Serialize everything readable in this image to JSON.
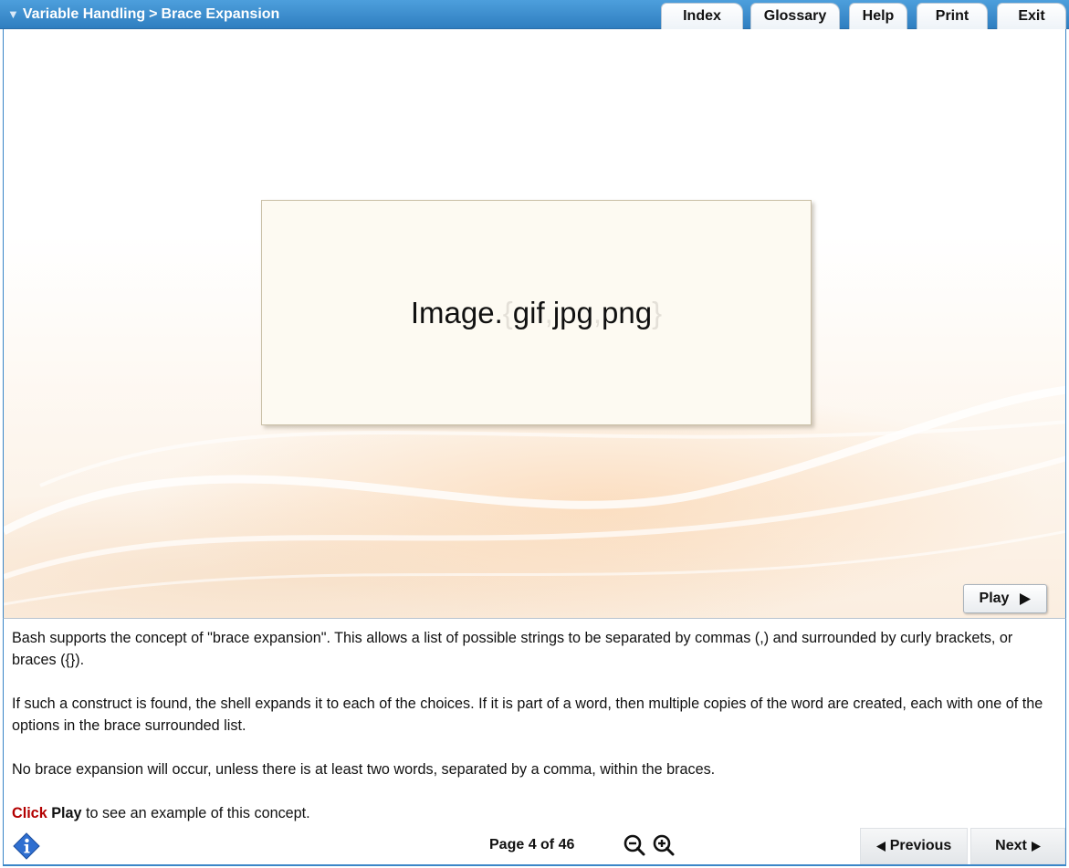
{
  "header": {
    "breadcrumb_section": "Variable Handling",
    "breadcrumb_separator": ">",
    "breadcrumb_page": "Brace Expansion",
    "tabs": [
      {
        "label": "Index"
      },
      {
        "label": "Glossary"
      },
      {
        "label": "Help"
      },
      {
        "label": "Print"
      },
      {
        "label": "Exit"
      }
    ]
  },
  "stage": {
    "image_prefix": "Image.",
    "brace_open": "{",
    "option1": "gif",
    "sep1": ",",
    "option2": "jpg",
    "sep2": ",",
    "option3": "png",
    "brace_close": "}",
    "play_label": "Play",
    "play_icon": "play-triangle-icon"
  },
  "text": {
    "p1": "Bash supports the concept of  \"brace expansion\". This allows a list of possible strings to be separated by commas (,) and surrounded by curly brackets, or braces ({}).",
    "p2": "If such a construct is found, the shell expands it to each of the choices. If it is part of a word, then multiple copies of the word are created, each with one of the options in the brace surrounded list.",
    "p3": "No brace expansion will occur, unless there is at least two words, separated by a comma, within the braces.",
    "p4_click": "Click",
    "p4_play": "Play",
    "p4_rest": " to see an example of this concept."
  },
  "footer": {
    "page_indicator": "Page 4 of 46",
    "previous_label": "Previous",
    "next_label": "Next",
    "icons": [
      "info-icon",
      "zoom-out-icon",
      "zoom-in-icon"
    ]
  },
  "colors": {
    "header_blue": "#3a8ad0",
    "click_red": "#b30000",
    "info_blue": "#2f6fd0"
  }
}
